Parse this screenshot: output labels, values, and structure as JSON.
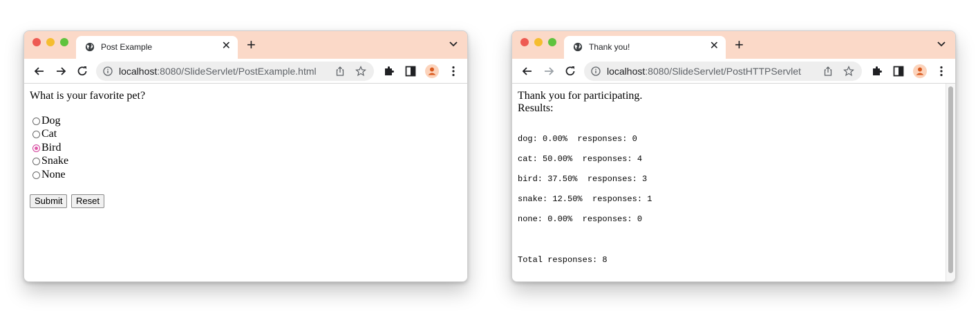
{
  "left_window": {
    "tab_title": "Post Example",
    "url_host": "localhost",
    "url_rest": ":8080/SlideServlet/PostExample.html",
    "question": "What is your favorite pet?",
    "options": [
      {
        "label": "Dog",
        "checked": false
      },
      {
        "label": "Cat",
        "checked": false
      },
      {
        "label": "Bird",
        "checked": true
      },
      {
        "label": "Snake",
        "checked": false
      },
      {
        "label": "None",
        "checked": false
      }
    ],
    "submit_label": "Submit",
    "reset_label": "Reset"
  },
  "right_window": {
    "tab_title": "Thank you!",
    "url_host": "localhost",
    "url_rest": ":8080/SlideServlet/PostHTTPServlet",
    "heading_line1": "Thank you for participating.",
    "heading_line2": "Results:",
    "results": [
      "dog: 0.00%  responses: 0",
      "cat: 50.00%  responses: 4",
      "bird: 37.50%  responses: 3",
      "snake: 12.50%  responses: 1",
      "none: 0.00%  responses: 0"
    ],
    "total": "Total responses: 8"
  },
  "colors": {
    "tabstrip": "#fbd9c8",
    "radio_accent": "#e05aa8",
    "avatar": "#f0924f"
  }
}
